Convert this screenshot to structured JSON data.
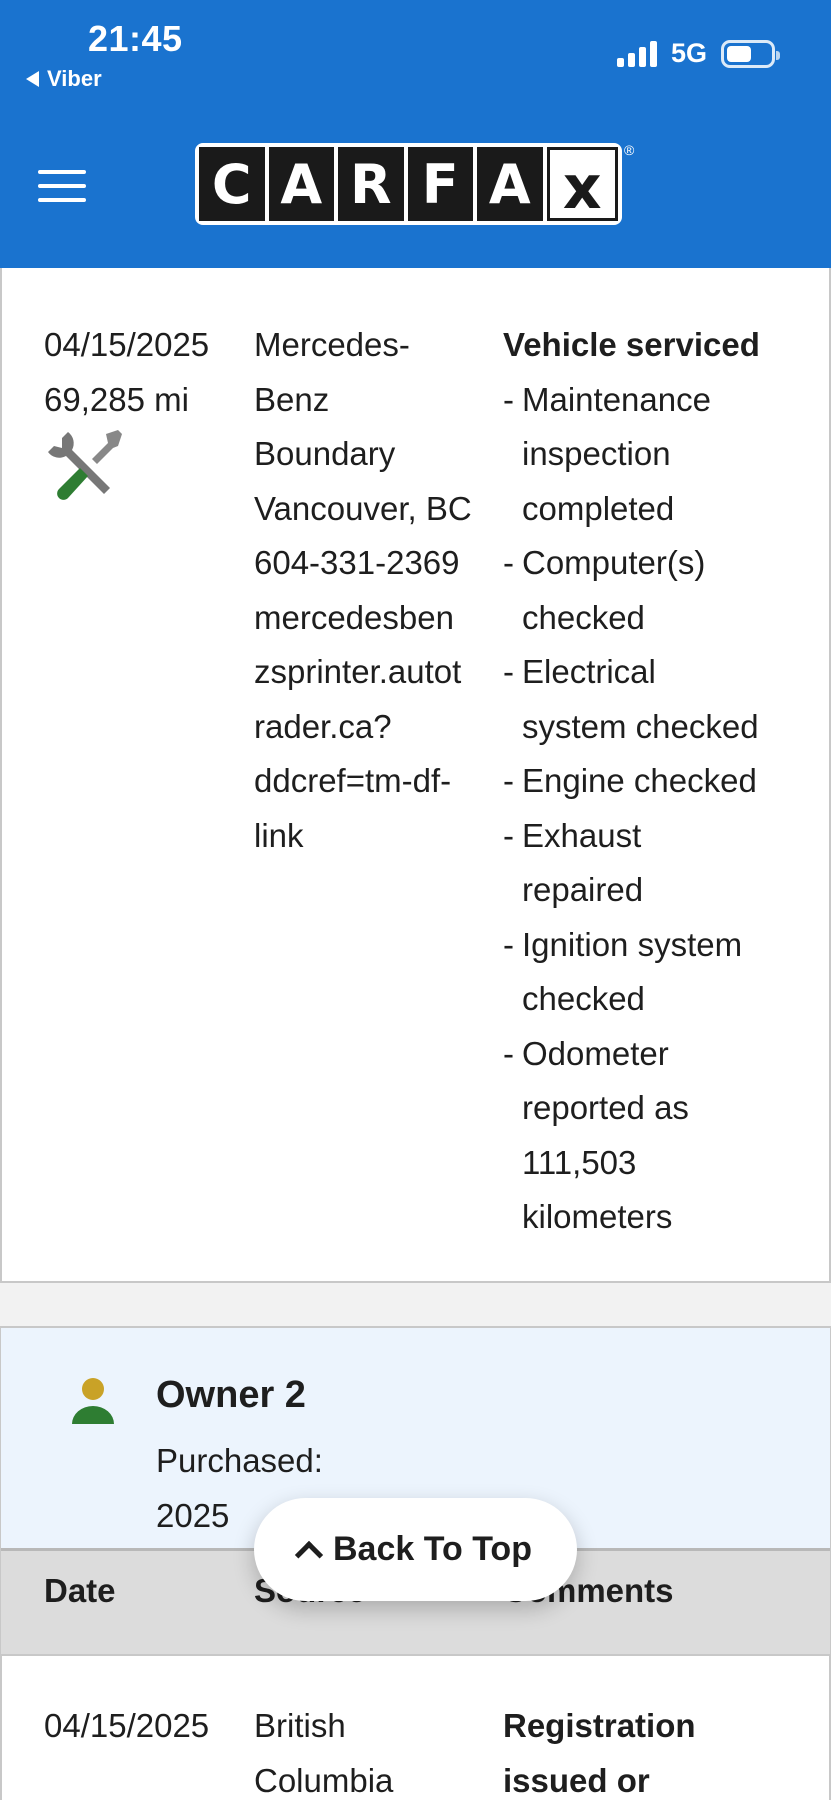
{
  "status_bar": {
    "time": "21:45",
    "back_app": "Viber",
    "network": "5G"
  },
  "header": {
    "logo_letters": [
      "C",
      "A",
      "R",
      "F",
      "A",
      "x"
    ],
    "registered_mark": "®"
  },
  "record1": {
    "date": "04/15/2025",
    "mileage": "69,285 mi",
    "source_lines": [
      "Mercedes-",
      "Benz",
      "Boundary",
      "Vancouver, BC",
      "604-331-2369",
      "mercedesben",
      "zsprinter.autot",
      "rader.ca?",
      "ddcref=tm-df-",
      "link"
    ],
    "comment_title": "Vehicle serviced",
    "comments": [
      [
        "Maintenance",
        "inspection",
        "completed"
      ],
      [
        "Computer(s)",
        "checked"
      ],
      [
        "Electrical",
        "system checked"
      ],
      [
        "Engine checked"
      ],
      [
        "Exhaust",
        "repaired"
      ],
      [
        "Ignition system",
        "checked"
      ],
      [
        "Odometer",
        "reported as",
        "111,503",
        "kilometers"
      ]
    ]
  },
  "owner": {
    "title": "Owner 2",
    "purchased_label": "Purchased:",
    "purchased_year": "2025"
  },
  "table_headers": {
    "date": "Date",
    "source": "Source",
    "comments": "Comments"
  },
  "record2": {
    "date": "04/15/2025",
    "source_lines": [
      "British",
      "Columbia"
    ],
    "comment_lines": [
      "Registration",
      "issued or"
    ]
  },
  "back_to_top": "Back To Top",
  "colors": {
    "header_bg": "#1a73cf",
    "owner_band": "#ecf4fd",
    "table_head": "#dcdcdc",
    "person_head": "#c9a227",
    "person_body": "#2e7d32",
    "wrench": "#777777",
    "screwdriver": "#2e7d32"
  }
}
